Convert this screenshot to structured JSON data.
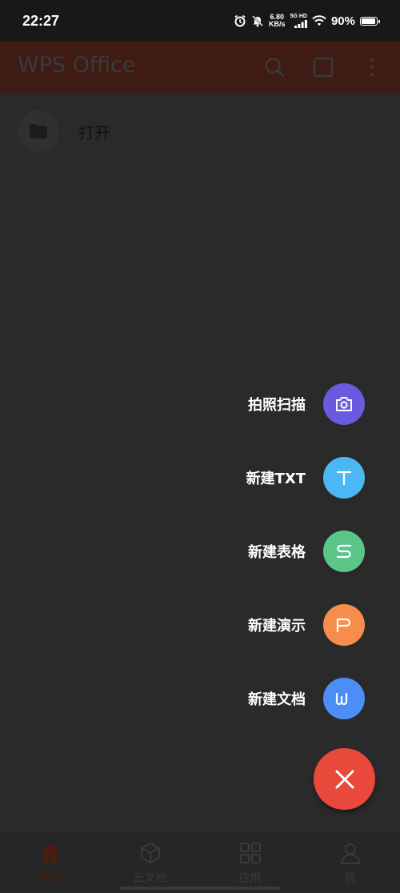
{
  "status_bar": {
    "time": "22:27",
    "net_speed_value": "6.80",
    "net_speed_unit": "KB/s",
    "net_type": "5G HD",
    "battery": "90%",
    "icons": [
      "alarm-icon",
      "mute-icon",
      "signal-icon",
      "wifi-icon",
      "battery-icon"
    ]
  },
  "app_bar": {
    "title": "WPS Office",
    "actions": [
      "search-icon",
      "square-icon",
      "more-vertical-icon"
    ],
    "color": "#3f1c13"
  },
  "content": {
    "open_label": "打开",
    "open_icon": "folder-icon"
  },
  "fab_menu": {
    "items": [
      {
        "label": "拍照扫描",
        "icon": "camera-icon",
        "color": "#6a5ae0"
      },
      {
        "label": "新建TXT",
        "icon": "text-t-icon",
        "color": "#4bb8f5"
      },
      {
        "label": "新建表格",
        "icon": "sheet-s-icon",
        "color": "#5cc58a"
      },
      {
        "label": "新建演示",
        "icon": "presentation-p-icon",
        "color": "#f78d4d"
      },
      {
        "label": "新建文档",
        "icon": "document-w-icon",
        "color": "#4b8ef5"
      }
    ],
    "close_icon": "close-icon",
    "close_color": "#e9493a"
  },
  "bottom_nav": {
    "items": [
      {
        "label": "最近",
        "icon": "home-icon",
        "active": true
      },
      {
        "label": "云文档",
        "icon": "cube-icon",
        "active": false
      },
      {
        "label": "应用",
        "icon": "grid-icon",
        "active": false
      },
      {
        "label": "我",
        "icon": "person-icon",
        "active": false
      }
    ]
  }
}
